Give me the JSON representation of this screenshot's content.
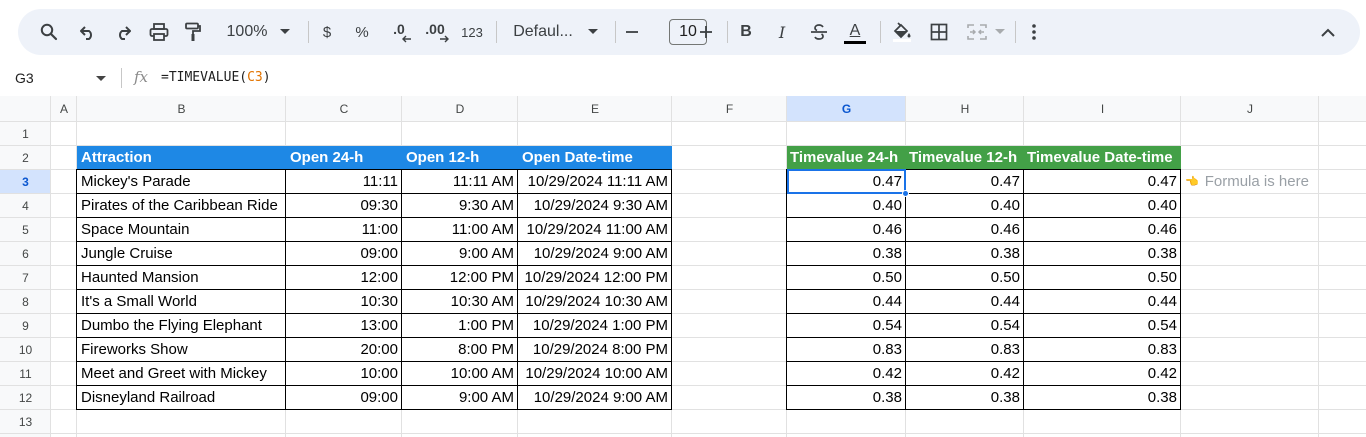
{
  "toolbar": {
    "zoom": "100%",
    "currency": "$",
    "percent": "%",
    "decrease_decimal": ".0",
    "increase_decimal": ".00",
    "number_format": "123",
    "font": "Defaul...",
    "font_size": "10",
    "bold": "B",
    "italic": "I",
    "text_color_letter": "A",
    "icons": [
      "search-icon",
      "undo-icon",
      "redo-icon",
      "print-icon",
      "paint-format-icon",
      "zoom-dropdown-icon",
      "font-dropdown-icon",
      "minus-icon",
      "plus-icon",
      "strikethrough-icon",
      "fill-color-icon",
      "borders-icon",
      "merge-cells-icon",
      "more-icon",
      "collapse-icon"
    ]
  },
  "formula_bar": {
    "name_box": "G3",
    "fx": "fx",
    "formula_prefix": "=TIMEVALUE(",
    "formula_ref": "C3",
    "formula_suffix": ")"
  },
  "columns": [
    "A",
    "B",
    "C",
    "D",
    "E",
    "F",
    "G",
    "H",
    "I",
    "J"
  ],
  "rows": [
    "1",
    "2",
    "3",
    "4",
    "5",
    "6",
    "7",
    "8",
    "9",
    "10",
    "11",
    "12",
    "13"
  ],
  "table1": {
    "headers": [
      "Attraction",
      "Open 24-h",
      "Open 12-h",
      "Open Date-time"
    ],
    "header_color": "#1e88e5",
    "rows": [
      [
        "Mickey's Parade",
        "11:11",
        "11:11 AM",
        "10/29/2024 11:11 AM"
      ],
      [
        "Pirates of the Caribbean Ride",
        "09:30",
        "9:30 AM",
        "10/29/2024 9:30 AM"
      ],
      [
        "Space Mountain",
        "11:00",
        "11:00 AM",
        "10/29/2024 11:00 AM"
      ],
      [
        "Jungle Cruise",
        "09:00",
        "9:00 AM",
        "10/29/2024 9:00 AM"
      ],
      [
        "Haunted Mansion",
        "12:00",
        "12:00 PM",
        "10/29/2024 12:00 PM"
      ],
      [
        "It's a Small World",
        "10:30",
        "10:30 AM",
        "10/29/2024 10:30 AM"
      ],
      [
        "Dumbo the Flying Elephant",
        "13:00",
        "1:00 PM",
        "10/29/2024 1:00 PM"
      ],
      [
        "Fireworks Show",
        "20:00",
        "8:00 PM",
        "10/29/2024 8:00 PM"
      ],
      [
        "Meet and Greet with Mickey",
        "10:00",
        "10:00 AM",
        "10/29/2024 10:00 AM"
      ],
      [
        "Disneyland Railroad",
        "09:00",
        "9:00 AM",
        "10/29/2024 9:00 AM"
      ]
    ]
  },
  "table2": {
    "headers": [
      "Timevalue 24-h",
      "Timevalue 12-h",
      "Timevalue Date-time"
    ],
    "header_color": "#43a047",
    "rows": [
      [
        "0.47",
        "0.47",
        "0.47"
      ],
      [
        "0.40",
        "0.40",
        "0.40"
      ],
      [
        "0.46",
        "0.46",
        "0.46"
      ],
      [
        "0.38",
        "0.38",
        "0.38"
      ],
      [
        "0.50",
        "0.50",
        "0.50"
      ],
      [
        "0.44",
        "0.44",
        "0.44"
      ],
      [
        "0.54",
        "0.54",
        "0.54"
      ],
      [
        "0.83",
        "0.83",
        "0.83"
      ],
      [
        "0.42",
        "0.42",
        "0.42"
      ],
      [
        "0.38",
        "0.38",
        "0.38"
      ]
    ]
  },
  "note": {
    "emoji": "👈",
    "text": "Formula is here"
  },
  "selection": {
    "cell": "G3",
    "color": "#1a73e8"
  }
}
